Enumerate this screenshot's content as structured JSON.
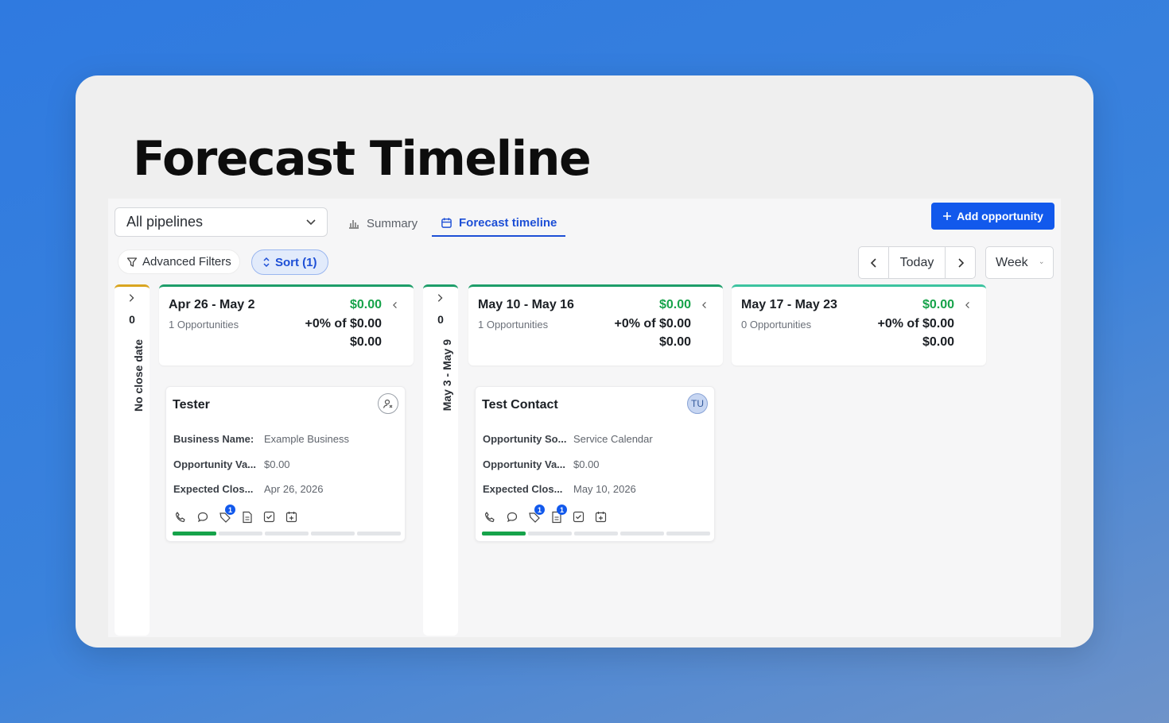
{
  "headline": "Forecast Timeline",
  "toolbar": {
    "pipeline": "All pipelines",
    "tab_summary": "Summary",
    "tab_forecast": "Forecast timeline",
    "add_opportunity": "Add opportunity",
    "advanced_filters": "Advanced Filters",
    "sort": "Sort (1)",
    "today": "Today",
    "period": "Week"
  },
  "collapsed_columns": [
    {
      "count": "0",
      "label": "No close date",
      "accent": "#d9a520"
    },
    {
      "count": "0",
      "label": "May 3 - May 9",
      "accent": "#1e9e6a"
    }
  ],
  "weeks": [
    {
      "range": "Apr 26 - May 2",
      "opportunities": "1 Opportunities",
      "amount": "$0.00",
      "percent": "+0% of $0.00",
      "total": "$0.00"
    },
    {
      "range": "May 10 - May 16",
      "opportunities": "1 Opportunities",
      "amount": "$0.00",
      "percent": "+0% of $0.00",
      "total": "$0.00"
    },
    {
      "range": "May 17 - May 23",
      "opportunities": "0 Opportunities",
      "amount": "$0.00",
      "percent": "+0% of $0.00",
      "total": "$0.00"
    }
  ],
  "cards": [
    {
      "name": "Tester",
      "avatar": "",
      "fields": [
        {
          "k": "Business Name:",
          "v": "Example Business"
        },
        {
          "k": "Opportunity Va...",
          "v": "$0.00"
        },
        {
          "k": "Expected Clos...",
          "v": "Apr 26, 2026"
        }
      ],
      "badges": {
        "tag": "1",
        "note": ""
      }
    },
    {
      "name": "Test Contact",
      "avatar": "TU",
      "fields": [
        {
          "k": "Opportunity So...",
          "v": "Service Calendar"
        },
        {
          "k": "Opportunity Va...",
          "v": "$0.00"
        },
        {
          "k": "Expected Clos...",
          "v": "May 10, 2026"
        }
      ],
      "badges": {
        "tag": "1",
        "note": "1"
      }
    }
  ],
  "colors": {
    "accent": "#1259ec",
    "positive": "#16a34a",
    "bg_gradient_start": "#2f7ae0"
  }
}
